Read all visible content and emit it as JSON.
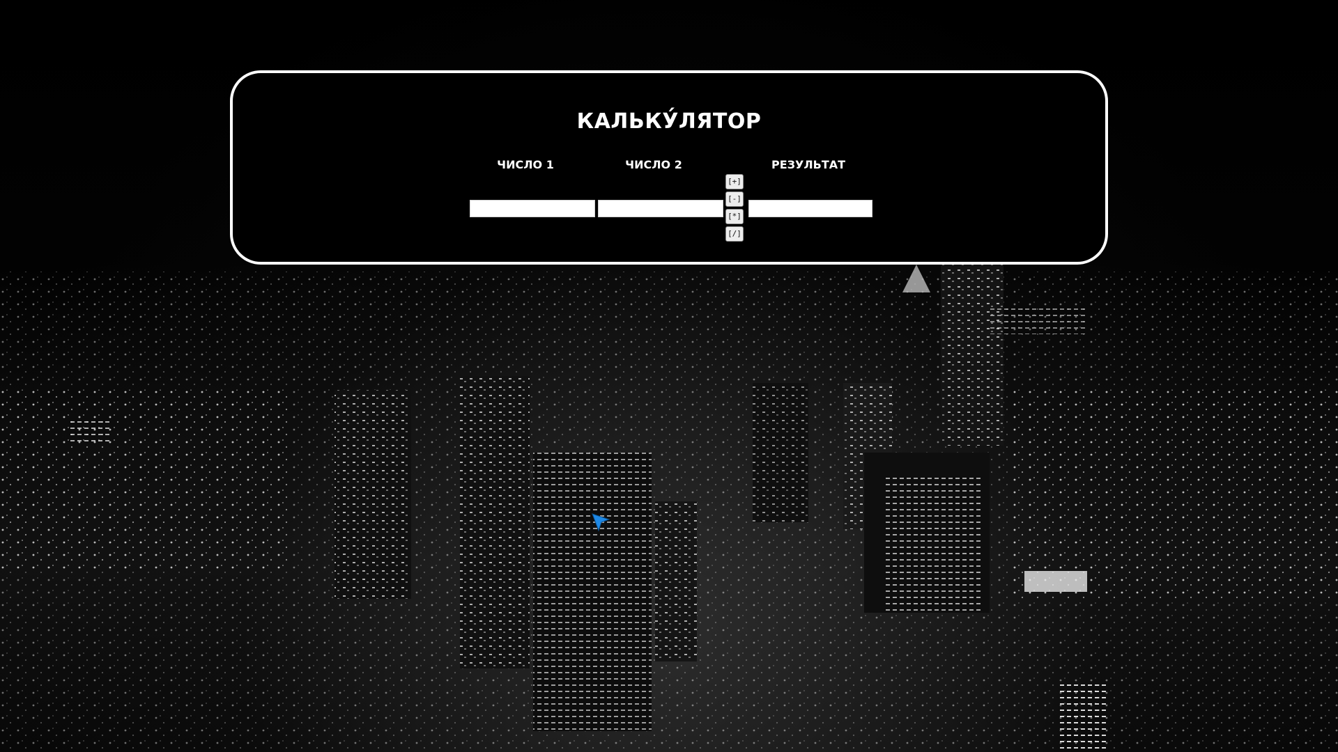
{
  "calculator": {
    "title": "КАЛЬКУ́ЛЯТОР",
    "labels": {
      "number1": "ЧИСЛО 1",
      "number2": "ЧИСЛО 2",
      "result": "РЕЗУЛЬТАТ"
    },
    "fields": {
      "number1_value": "",
      "number2_value": "",
      "result_value": ""
    },
    "operations": [
      "[+]",
      "[-]",
      "[*]",
      "[/]"
    ]
  },
  "colors": {
    "panel_border": "#ffffff",
    "panel_background": "#000000",
    "text": "#ffffff",
    "cursor": "#1e88e5"
  },
  "background": {
    "icon": "night-city-photo"
  },
  "pointer": {
    "icon": "mouse-pointer-icon"
  }
}
